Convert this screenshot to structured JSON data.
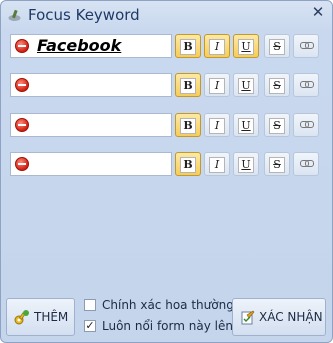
{
  "window": {
    "title": "Focus Keyword"
  },
  "keywords": [
    {
      "text": "Facebook",
      "bold": true,
      "italic": true,
      "underline": true,
      "strike": false
    },
    {
      "text": "",
      "bold": true,
      "italic": false,
      "underline": false,
      "strike": false
    },
    {
      "text": "",
      "bold": true,
      "italic": false,
      "underline": false,
      "strike": false
    },
    {
      "text": "",
      "bold": true,
      "italic": false,
      "underline": false,
      "strike": false
    }
  ],
  "format_buttons": {
    "bold": "B",
    "italic": "I",
    "underline": "U",
    "strike": "S"
  },
  "footer": {
    "add_label": "THÊM",
    "confirm_label": "XÁC NHẬN",
    "options": [
      {
        "label": "Chính xác hoa thường",
        "checked": false
      },
      {
        "label": "Luôn nổi form này lên",
        "checked": true
      }
    ]
  },
  "colors": {
    "active_button": "#f7cd58",
    "window_bg": "#c4d5ec",
    "title_text": "#1f3a66"
  },
  "icons": {
    "app": "pen-icon",
    "remove": "remove-icon",
    "link": "link-icon",
    "add": "key-icon",
    "confirm": "confirm-icon"
  }
}
